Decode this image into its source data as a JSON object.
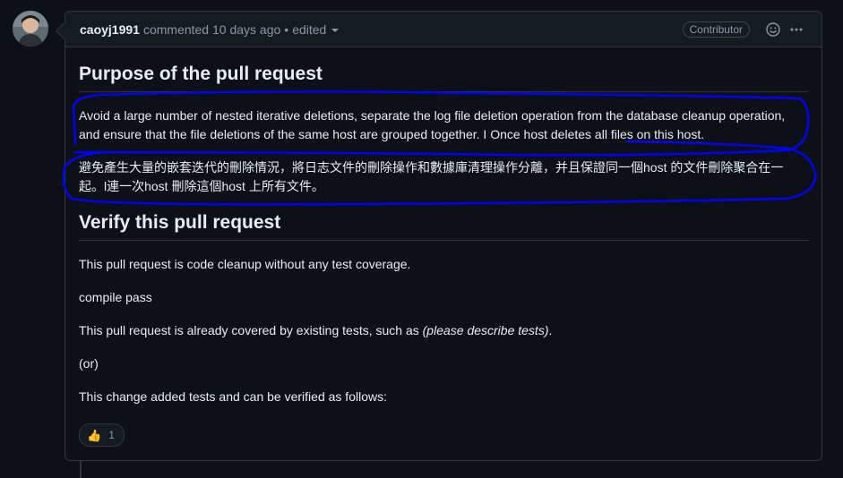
{
  "comment": {
    "author": "caoyj1991",
    "meta": "commented 10 days ago",
    "separator": "•",
    "edited_label": "edited",
    "badge": "Contributor",
    "accent_color": "#0000ff"
  },
  "body": {
    "heading_purpose": "Purpose of the pull request",
    "purpose_en": "Avoid a large number of nested iterative deletions, separate the log file deletion operation from the database cleanup operation, and ensure that the file deletions of the same host are grouped together. I Once host deletes all files on this host.",
    "purpose_zh": "避免產生大量的嵌套迭代的刪除情況，將日志文件的刪除操作和數據庫清理操作分離，并且保證同一個host 的文件刪除聚合在一起。l連一次host 刪除這個host 上所有文件。",
    "heading_verify": "Verify this pull request",
    "verify_1": "This pull request is code cleanup without any test coverage.",
    "verify_2": "compile pass",
    "verify_3_prefix": "This pull request is already covered by existing tests, such as ",
    "verify_3_em": "(please describe tests)",
    "verify_3_suffix": ".",
    "verify_4": "(or)",
    "verify_5": "This change added tests and can be verified as follows:"
  },
  "reaction": {
    "emoji": "👍",
    "count": "1"
  },
  "icons": {
    "smiley": "smiley-icon",
    "kebab": "kebab-horizontal-icon",
    "avatar": "avatar"
  }
}
